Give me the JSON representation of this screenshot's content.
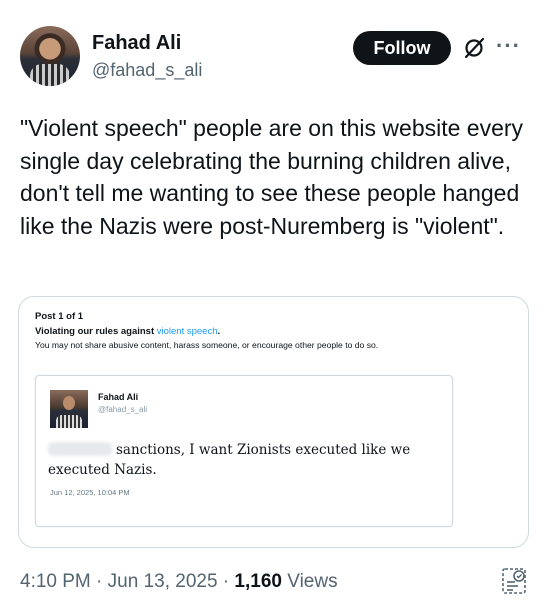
{
  "author": {
    "display_name": "Fahad Ali",
    "handle": "@fahad_s_ali"
  },
  "actions": {
    "follow_label": "Follow",
    "grok_icon": "grok-slash-circle-icon",
    "more_icon": "more-dots-icon",
    "more_glyph": "···"
  },
  "tweet": {
    "text": "\"Violent speech\" people are on this website every single day celebrating the burning children alive, don't tell me wanting to see these people hanged like the Nazis were post-Nuremberg is \"violent\"."
  },
  "quote_card": {
    "post_count": "Post 1 of 1",
    "violation_prefix": "Violating our rules against ",
    "violation_link": "violent speech",
    "violation_suffix": ".",
    "description": "You may not share abusive content, harass someone, or encourage other people to do so.",
    "inner_post": {
      "display_name": "Fahad Ali",
      "handle": "@fahad_s_ali",
      "body": "sanctions, I want Zionists executed like we executed Nazis.",
      "timestamp": "Jun 12, 2025, 10:04 PM"
    }
  },
  "meta": {
    "time": "4:10 PM",
    "separator": " · ",
    "date": "Jun 13, 2025",
    "views_count": "1,160",
    "views_label": " Views",
    "analytics_icon": "analytics-icon"
  },
  "colors": {
    "link": "#1d9bf0",
    "secondary_text": "#536471",
    "follow_bg": "#0f1419"
  }
}
